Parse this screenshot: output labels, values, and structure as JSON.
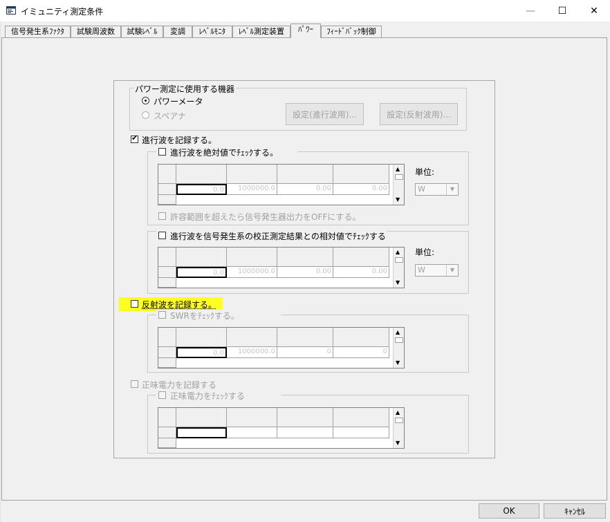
{
  "window": {
    "title": "イミュニティ測定条件",
    "minimize_glyph": "—",
    "maximize_glyph": "☐",
    "close_glyph": "✕"
  },
  "tabs": [
    {
      "label": "信号発生系ﾌｧｸﾀ",
      "active": false
    },
    {
      "label": "試験周波数",
      "active": false
    },
    {
      "label": "試験ﾚﾍﾞﾙ",
      "active": false
    },
    {
      "label": "変調",
      "active": false
    },
    {
      "label": "ﾚﾍﾞﾙﾓﾆﾀ",
      "active": false
    },
    {
      "label": "ﾚﾍﾞﾙ測定装置",
      "active": false
    },
    {
      "label": "ﾊﾟﾜｰ",
      "active": true
    },
    {
      "label": "ﾌｨｰﾄﾞﾊﾞｯｸ制御",
      "active": false
    }
  ],
  "device_group": {
    "legend": "パワー測定に使用する機器",
    "radio_power_meter": "パワーメータ",
    "radio_spectrum": "スペアナ",
    "btn_forward": "設定(進行波用)...",
    "btn_reflect": "設定(反射波用)..."
  },
  "forward": {
    "record_label": "進行波を記録する。",
    "record_checked": true,
    "abs_check_label": "進行波を絶対値でﾁｪｯｸする。",
    "abs_row": [
      "0.0",
      "1000000.0",
      "0.00",
      "0.00"
    ],
    "unit_label": "単位:",
    "unit_value": "W",
    "offlimit_label": "許容範囲を超えたら信号発生器出力をOFFにする。",
    "rel_check_label": "進行波を信号発生系の校正測定結果との相対値でﾁｪｯｸする",
    "rel_row": [
      "0.0",
      "1000000.0",
      "0.00",
      "0.00"
    ],
    "unit_label2": "単位:",
    "unit_value2": "W"
  },
  "reflect": {
    "record_label": "反射波を記録する。",
    "record_checked": false,
    "swr_label": "SWRをﾁｪｯｸする。",
    "swr_row": [
      "0.0",
      "1000000.0",
      "0",
      "0"
    ]
  },
  "net_power": {
    "record_label": "正味電力を記録する",
    "check_label": "正味電力をﾁｪｯｸする",
    "row": [
      "",
      "",
      "",
      ""
    ]
  },
  "footer": {
    "ok_label": "OK",
    "cancel_label": "ｷｬﾝｾﾙ"
  },
  "colors": {
    "highlight": "#ffff22",
    "disabled_text": "#a0a0a0"
  },
  "icons": {
    "app": "window-app-icon",
    "check": "✔",
    "scroll_up": "▲",
    "scroll_down": "▼",
    "combo_down": "▼"
  }
}
